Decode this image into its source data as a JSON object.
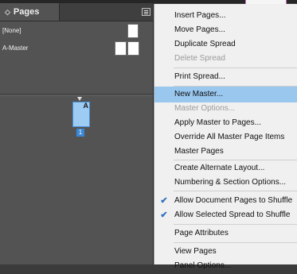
{
  "panel": {
    "tab_label": "Pages",
    "masters": [
      {
        "label": "[None]"
      },
      {
        "label": "A-Master"
      }
    ],
    "page": {
      "number": "1",
      "master_prefix": "A"
    }
  },
  "menu": {
    "items": [
      {
        "label": "Insert Pages...",
        "state": "enabled"
      },
      {
        "label": "Move Pages...",
        "state": "enabled"
      },
      {
        "label": "Duplicate Spread",
        "state": "enabled"
      },
      {
        "label": "Delete Spread",
        "state": "disabled"
      },
      {
        "label": "Print Spread...",
        "state": "enabled"
      },
      {
        "label": "New Master...",
        "state": "highlighted"
      },
      {
        "label": "Master Options...",
        "state": "disabled"
      },
      {
        "label": "Apply Master to Pages...",
        "state": "enabled"
      },
      {
        "label": "Override All Master Page Items",
        "state": "enabled"
      },
      {
        "label": "Master Pages",
        "state": "enabled"
      },
      {
        "label": "Create Alternate Layout...",
        "state": "enabled"
      },
      {
        "label": "Numbering & Section Options...",
        "state": "enabled"
      },
      {
        "label": "Allow Document Pages to Shuffle",
        "state": "checked"
      },
      {
        "label": "Allow Selected Spread to Shuffle",
        "state": "checked"
      },
      {
        "label": "Page Attributes",
        "state": "enabled"
      },
      {
        "label": "View Pages",
        "state": "enabled"
      },
      {
        "label": "Panel Options...",
        "state": "enabled"
      }
    ]
  },
  "colors": {
    "highlight": "#99c7ee",
    "page_thumb": "#9ecbf2",
    "page_number_badge": "#3b86d6",
    "check": "#2f6fc0"
  }
}
